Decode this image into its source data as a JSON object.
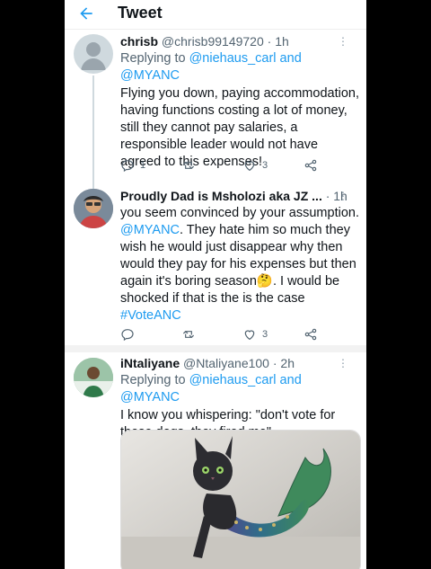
{
  "header": {
    "title": "Tweet"
  },
  "tweets": [
    {
      "name": "chrisb",
      "handle": "@chrisb99149720",
      "time": "· 1h",
      "replying_label": "Replying to ",
      "replying_to_1": "@niehaus_carl",
      "replying_and": " and ",
      "replying_to_2": "@MYANC",
      "text": "Flying you down, paying accommodation, having functions costing a lot of money, still they cannot pay salaries, a responsible leader would not have agreed to this expenses!",
      "reply_count": "1",
      "retweet_count": "",
      "like_count": "3"
    },
    {
      "name": "Proudly Dad is Msholozi aka JZ ...",
      "handle": "",
      "time": "· 1h",
      "text_1": "you seem convinced by your assumption.",
      "mention": "@MYANC",
      "text_2": ".  They hate him so much they wish he would just disappear why then would they pay for his  expenses but then again it's boring season",
      "emoji": "🤔",
      "text_3": ". I would be shocked if that is the is the case",
      "hashtag": "#VoteANC",
      "reply_count": "",
      "retweet_count": "",
      "like_count": "3"
    },
    {
      "name": "iNtaliyane",
      "handle": "@Ntaliyane100",
      "time": "· 2h",
      "replying_label": "Replying to ",
      "replying_to_1": "@niehaus_carl",
      "replying_and": " and ",
      "replying_to_2": "@MYANC",
      "text": "I know you whispering: \"don't vote for these dogs, they fired me\""
    }
  ],
  "icons": {
    "back": "arrow-left-icon",
    "reply": "reply-icon",
    "retweet": "retweet-icon",
    "like": "heart-icon",
    "share": "share-icon",
    "more": "more-icon"
  },
  "colors": {
    "accent": "#1d9bf0",
    "muted": "#536471",
    "background": "#ffffff"
  }
}
